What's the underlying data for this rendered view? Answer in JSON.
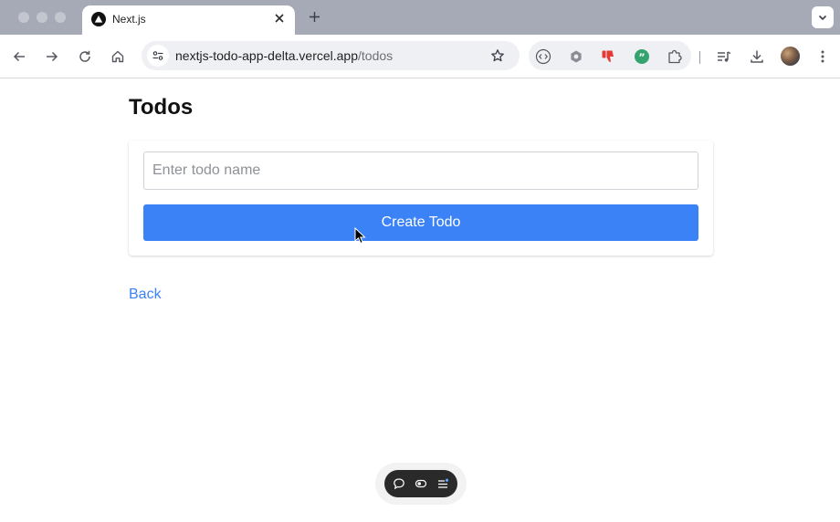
{
  "browser": {
    "tab": {
      "title": "Next.js",
      "favicon": "nextjs-triangle-icon"
    },
    "address": {
      "host": "nextjs-todo-app-delta.vercel.app",
      "path": "/todos"
    },
    "colors": {
      "tabstrip": "#a6a9b6",
      "omnibox": "#eef0f4"
    }
  },
  "page": {
    "title": "Todos",
    "input": {
      "value": "",
      "placeholder": "Enter todo name"
    },
    "create_button": "Create Todo",
    "back_link": "Back",
    "colors": {
      "accent": "#3b82f6"
    }
  },
  "devbar": {
    "icons": [
      "comment-icon",
      "toggle-icon",
      "list-menu-icon"
    ]
  }
}
